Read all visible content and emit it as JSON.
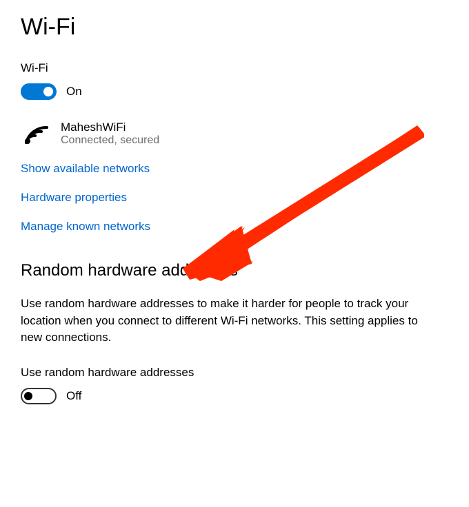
{
  "page": {
    "title": "Wi-Fi"
  },
  "wifi": {
    "label": "Wi-Fi",
    "toggle_state": "On",
    "toggle_on": true
  },
  "network": {
    "name": "MaheshWiFi",
    "status": "Connected, secured"
  },
  "links": {
    "show_available": "Show available networks",
    "hardware_properties": "Hardware properties",
    "manage_known": "Manage known networks"
  },
  "random_hw": {
    "heading": "Random hardware addresses",
    "description": "Use random hardware addresses to make it harder for people to track your location when you connect to different Wi-Fi networks. This setting applies to new connections.",
    "label": "Use random hardware addresses",
    "toggle_state": "Off",
    "toggle_on": false
  }
}
